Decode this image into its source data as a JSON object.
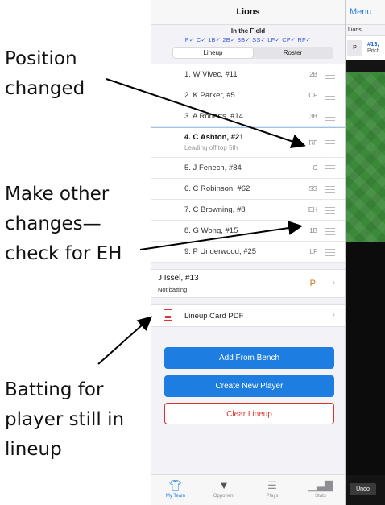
{
  "annotations": {
    "position_changed": "Position\nchanged",
    "make_other_changes": "Make other\nchanges—\ncheck for EH",
    "batting_for": "Batting for\nplayer still in\nlineup"
  },
  "panel": {
    "title": "Lions",
    "in_the_field": "In the Field",
    "positions_status": "P✓ C✓ 1B✓ 2B✓ 3B✓ SS✓ LF✓ CF✓ RF✓",
    "segments": [
      "Lineup",
      "Roster"
    ],
    "lineup": [
      {
        "name": "1. W Vivec, #11",
        "pos": "2B"
      },
      {
        "name": "2. K Parker, #5",
        "pos": "CF"
      },
      {
        "name": "3. A Roberts, #14",
        "pos": "3B"
      },
      {
        "name": "4. C Ashton, #21",
        "pos": "RF",
        "sub": "Leading off top 5th"
      },
      {
        "name": "5. J Fenech, #84",
        "pos": "C"
      },
      {
        "name": "6. C Robinson, #62",
        "pos": "SS"
      },
      {
        "name": "7. C Browning, #8",
        "pos": "EH"
      },
      {
        "name": "8. G Wong, #15",
        "pos": "1B"
      },
      {
        "name": "9. P Underwood, #25",
        "pos": "LF"
      }
    ],
    "bench_player": {
      "name": "J Issel, #13",
      "status": "Not batting",
      "pos": "P"
    },
    "pdf_label": "Lineup Card PDF",
    "buttons": {
      "add_from_bench": "Add From Bench",
      "create_new": "Create New Player",
      "clear": "Clear Lineup"
    },
    "tabs": [
      "My Team",
      "Opponent",
      "Plays",
      "Stats"
    ]
  },
  "right_app": {
    "menu": "Menu",
    "team": "Lions",
    "pitcher_box": "P",
    "pitcher_num": "#13,",
    "pitcher_label": "Pitch",
    "undo": "Undo"
  },
  "colors": {
    "accent": "#1e7de0",
    "danger": "#d9332b",
    "field": "#3b8a3a"
  }
}
